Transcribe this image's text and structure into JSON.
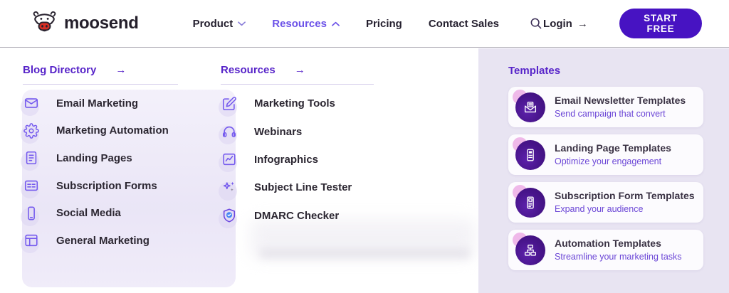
{
  "colors": {
    "accent_purple": "#6c52e8",
    "heading_purple": "#5724c9",
    "cta_purple": "#4713c2",
    "panel_lavender": "#e8e4f2",
    "icon_purple": "#7459ee",
    "check_blue": "#4285f4",
    "logo_red": "#d93025"
  },
  "header": {
    "brand": "moosend",
    "nav": [
      {
        "label": "Product",
        "state": "collapsed"
      },
      {
        "label": "Resources",
        "state": "expanded"
      },
      {
        "label": "Pricing"
      },
      {
        "label": "Contact Sales"
      }
    ],
    "login": {
      "label": "Login",
      "arrow": "→"
    },
    "cta": {
      "label": "START FREE"
    }
  },
  "menu": {
    "blog_directory": {
      "title": "Blog Directory",
      "arrow": "→",
      "items": [
        {
          "label": "Email Marketing",
          "icon": "envelope-icon"
        },
        {
          "label": "Marketing Automation",
          "icon": "gear-icon"
        },
        {
          "label": "Landing Pages",
          "icon": "document-icon"
        },
        {
          "label": "Subscription Forms",
          "icon": "form-icon"
        },
        {
          "label": "Social Media",
          "icon": "phone-icon"
        },
        {
          "label": "General Marketing",
          "icon": "layout-icon"
        }
      ]
    },
    "resources": {
      "title": "Resources",
      "arrow": "→",
      "items": [
        {
          "label": "Marketing Tools",
          "icon": "pencil-icon"
        },
        {
          "label": "Webinars",
          "icon": "headphones-icon"
        },
        {
          "label": "Infographics",
          "icon": "chart-icon"
        },
        {
          "label": "Subject Line Tester",
          "icon": "sparkles-icon"
        },
        {
          "label": "DMARC Checker",
          "icon": "shield-check-icon"
        }
      ]
    },
    "templates": {
      "title": "Templates",
      "cards": [
        {
          "title": "Email Newsletter Templates",
          "subtitle": "Send campaign that convert",
          "icon": "envelope-open-icon"
        },
        {
          "title": "Landing Page Templates",
          "subtitle": "Optimize your engagement",
          "icon": "landing-page-icon"
        },
        {
          "title": "Subscription Form Templates",
          "subtitle": "Expand your audience",
          "icon": "subscription-form-icon"
        },
        {
          "title": "Automation Templates",
          "subtitle": "Streamline your marketing tasks",
          "icon": "automation-icon"
        }
      ]
    }
  }
}
